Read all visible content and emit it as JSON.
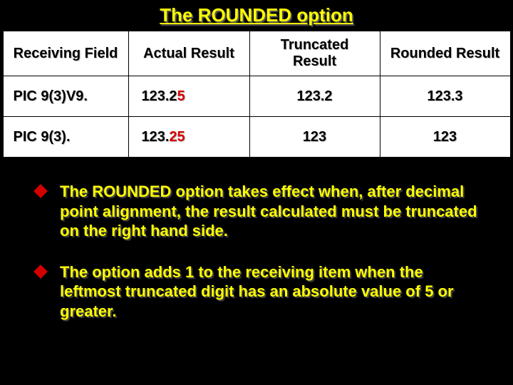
{
  "title": "The ROUNDED option",
  "table": {
    "headers": [
      "Receiving Field",
      "Actual Result",
      "Truncated Result",
      "Rounded Result"
    ],
    "rows": [
      {
        "receiving": "PIC 9(3)V9.",
        "actual_pre": "123.2",
        "actual_red": "5",
        "truncated": "123.2",
        "rounded": "123.3"
      },
      {
        "receiving": "PIC 9(3).",
        "actual_pre": "123.",
        "actual_red": "25",
        "truncated": "123",
        "rounded": "123"
      }
    ]
  },
  "bullets": [
    "The ROUNDED option takes effect when, after decimal point alignment, the result calculated must be truncated on the right hand side.",
    "The option adds 1 to the receiving item when the leftmost truncated digit has an absolute value of 5 or greater."
  ]
}
